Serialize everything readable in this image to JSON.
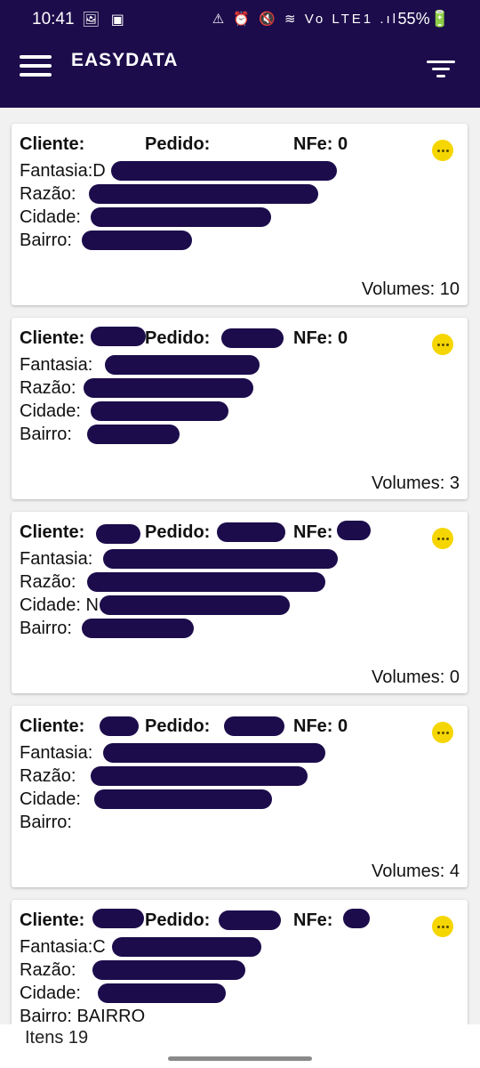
{
  "status_bar": {
    "time": "10:41",
    "left_icons": "🖼 ▣",
    "right_icons": "⚠ ⏰ 🔇 ≋ Vo LTE1 .ıl",
    "battery": "55%🔋"
  },
  "app_bar": {
    "title": "EASYDATA",
    "menu_icon": "hamburger-icon",
    "filter_icon": "filter-icon"
  },
  "labels": {
    "cliente": "Cliente:",
    "pedido": "Pedido:",
    "nfe": "NFe:",
    "fantasia": "Fantasia:",
    "razao": "Razão:",
    "cidade": "Cidade:",
    "bairro": "Bairro:"
  },
  "cards": [
    {
      "cliente": "",
      "pedido": "",
      "nfe": "NFe: 0",
      "fantasia": "Fantasia:D",
      "razao": "Razão:",
      "cidade": "Cidade:",
      "bairro": "Bairro:",
      "volumes": "Volumes: 10"
    },
    {
      "cliente": "",
      "pedido": "",
      "nfe": "NFe: 0",
      "fantasia": "Fantasia:",
      "razao": "Razão:",
      "cidade": "Cidade:",
      "bairro": "Bairro:",
      "volumes": "Volumes: 3"
    },
    {
      "cliente": "",
      "pedido": "",
      "nfe": "NFe:",
      "fantasia": "Fantasia:",
      "razao": "Razão:",
      "cidade": "Cidade: N",
      "bairro": "Bairro:",
      "volumes": "Volumes: 0"
    },
    {
      "cliente": "",
      "pedido": "",
      "nfe": "NFe: 0",
      "fantasia": "Fantasia:",
      "razao": "Razão:",
      "cidade": "Cidade:",
      "bairro": "Bairro:",
      "volumes": "Volumes: 4"
    },
    {
      "cliente": "",
      "pedido": "",
      "nfe": "NFe:",
      "fantasia": "Fantasia:C",
      "razao": "Razão:",
      "cidade": "Cidade:",
      "bairro": "Bairro: BAIRRO",
      "volumes": ""
    }
  ],
  "footer": {
    "items_count": "Itens 19"
  },
  "colors": {
    "primary": "#1c0c4b",
    "accent": "#f5d600",
    "card_bg": "#ffffff"
  }
}
